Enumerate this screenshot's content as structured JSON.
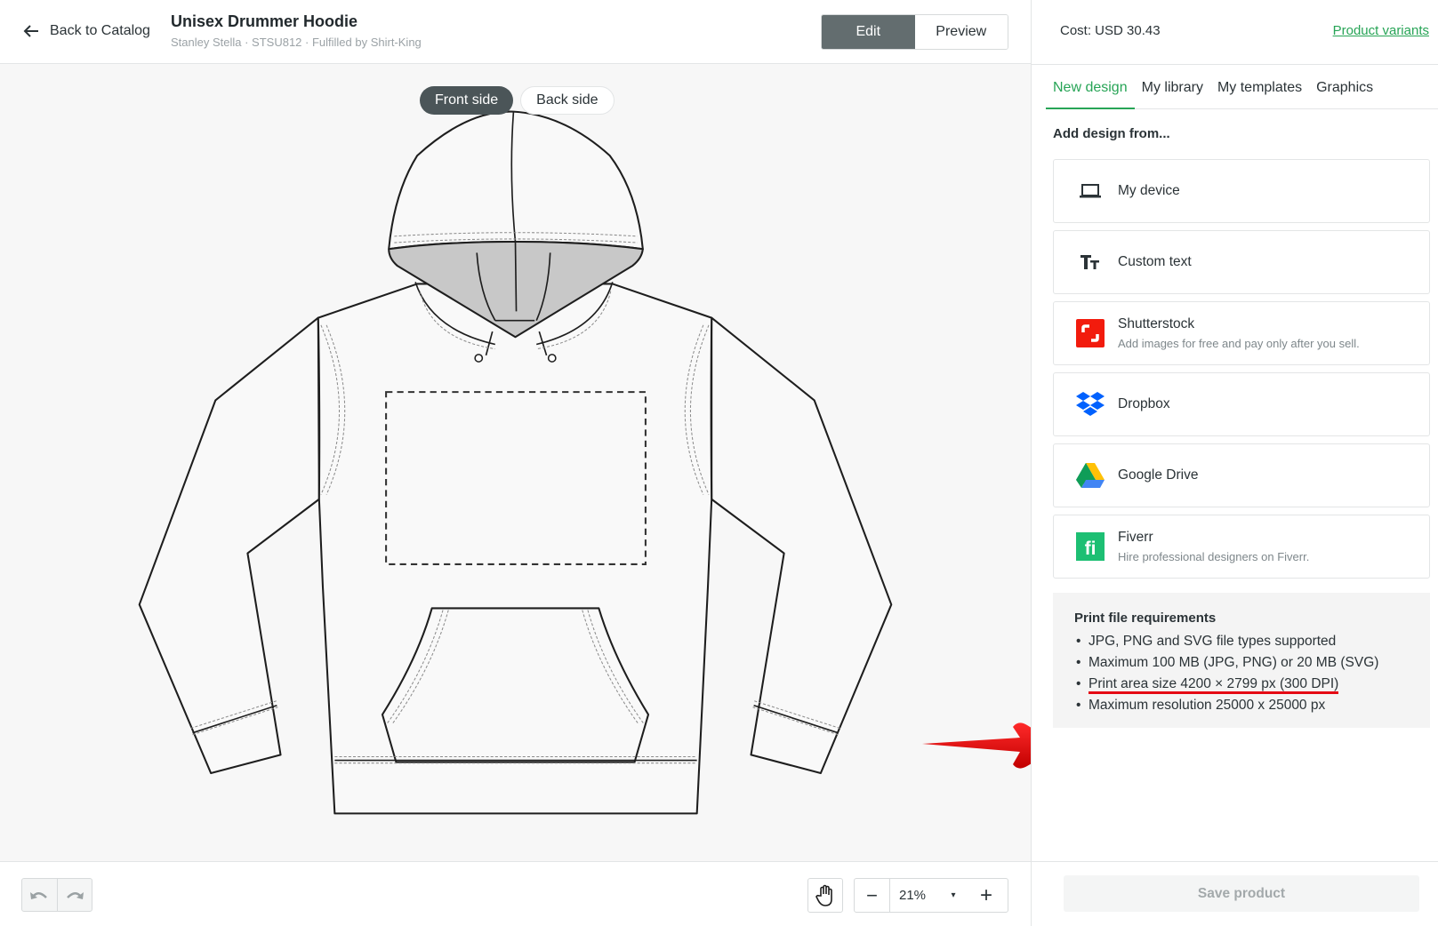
{
  "header": {
    "back_label": "Back to Catalog",
    "title": "Unisex Drummer Hoodie",
    "subtitle": "Stanley Stella · STSU812 · Fulfilled by Shirt-King",
    "mode_edit": "Edit",
    "mode_preview": "Preview",
    "active_mode": "Edit"
  },
  "canvas": {
    "sides": [
      "Front side",
      "Back side"
    ],
    "active_side": "Front side"
  },
  "bottom": {
    "zoom_value": "21%",
    "zoom_minus": "−",
    "zoom_plus": "+",
    "zoom_caret": "▾"
  },
  "right_panel": {
    "cost": "Cost: USD 30.43",
    "variants_link": "Product variants",
    "tabs": [
      "New design",
      "My library",
      "My templates",
      "Graphics"
    ],
    "active_tab": "New design",
    "add_from": "Add design from...",
    "sources": [
      {
        "label": "My device",
        "icon": "laptop-icon"
      },
      {
        "label": "Custom text",
        "icon": "text-icon"
      },
      {
        "label": "Shutterstock",
        "desc": "Add images for free and pay only after you sell.",
        "icon": "shutterstock-icon"
      },
      {
        "label": "Dropbox",
        "icon": "dropbox-icon"
      },
      {
        "label": "Google Drive",
        "icon": "google-drive-icon"
      },
      {
        "label": "Fiverr",
        "desc": "Hire professional designers on Fiverr.",
        "icon": "fiverr-icon"
      }
    ],
    "requirements": {
      "title": "Print file requirements",
      "items": [
        "JPG, PNG and SVG file types supported",
        "Maximum 100 MB (JPG, PNG) or 20 MB (SVG)",
        "Print area size 4200 × 2799 px (300 DPI)",
        "Maximum resolution 25000 x 25000 px"
      ],
      "highlighted_index": 2
    },
    "save_label": "Save product"
  },
  "colors": {
    "accent_green": "#27a456",
    "edit_active": "#636d6f",
    "annotation_red": "#e50914",
    "shutterstock": "#f21b0d",
    "dropbox": "#0061fe",
    "fiverr": "#1dbf73"
  }
}
